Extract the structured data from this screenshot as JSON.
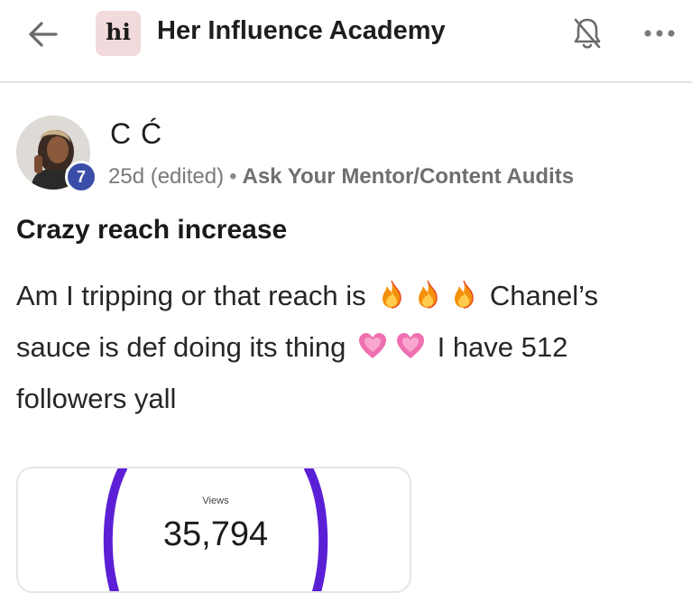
{
  "header": {
    "title": "Her Influence Academy",
    "logo_text": "hi",
    "icons": {
      "back": "arrow-left-icon",
      "notifications": "bell-off-icon",
      "more": "more-horizontal-icon"
    }
  },
  "post": {
    "author_name": "C Ć",
    "level": "7",
    "timestamp": "25d (edited)",
    "separator": "•",
    "category": "Ask Your Mentor/Content Audits",
    "title": "Crazy reach increase",
    "body": {
      "line1_text": "Am I tripping or that reach is",
      "line1_after": "Chanel’s",
      "line2_text": "sauce is def doing its thing",
      "line2_after": "I have 512",
      "line3_text": "followers yall",
      "emoji_fire": "fire-emoji",
      "emoji_heart": "growing-heart-emoji"
    },
    "attachment": {
      "label": "Views",
      "value": "35,794",
      "ring_color": "#5b1fd6"
    }
  },
  "colors": {
    "level_badge": "#3a4da8",
    "logo_bg": "#f1d9dc",
    "divider": "#e4e4e4"
  }
}
